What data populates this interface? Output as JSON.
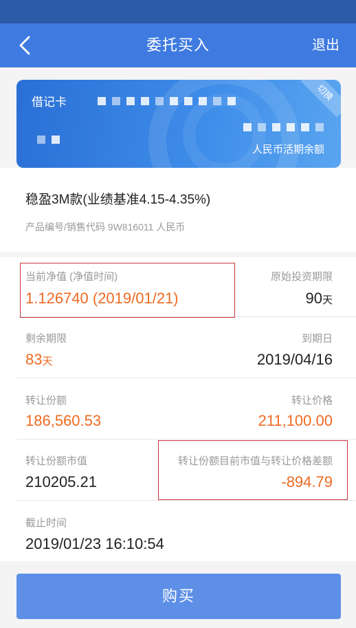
{
  "nav": {
    "title": "委托买入",
    "exit_label": "退出"
  },
  "card": {
    "type_label": "借记卡",
    "switch_label": "切换",
    "balance_label": "人民币活期余额"
  },
  "product": {
    "name": "稳盈3M款(业绩基准4.15-4.35%)",
    "code_line": "产品编号/销售代码 9W816011 人民币"
  },
  "details": {
    "nav_label": "当前净值 (净值时间)",
    "nav_value": "1.126740 (2019/01/21)",
    "orig_term_label": "原始投资期限",
    "orig_term_value": "90",
    "orig_term_unit": "天",
    "remaining_label": "剩余期限",
    "remaining_value": "83",
    "remaining_unit": "天",
    "maturity_label": "到期日",
    "maturity_value": "2019/04/16",
    "transfer_share_label": "转让份额",
    "transfer_share_value": "186,560.53",
    "transfer_price_label": "转让价格",
    "transfer_price_value": "211,100.00",
    "market_value_label": "转让份额市值",
    "market_value_value": "210205.21",
    "diff_label": "转让份额目前市值与转让价格差额",
    "diff_value": "-894.79",
    "deadline_label": "截止时间",
    "deadline_value": "2019/01/23 16:10:54"
  },
  "buy_label": "购买",
  "colors": {
    "nav_blue": "#3e7ae0",
    "accent_orange": "#ee6a22",
    "highlight_red": "#c8323a",
    "button_blue": "#5d8fe6"
  }
}
